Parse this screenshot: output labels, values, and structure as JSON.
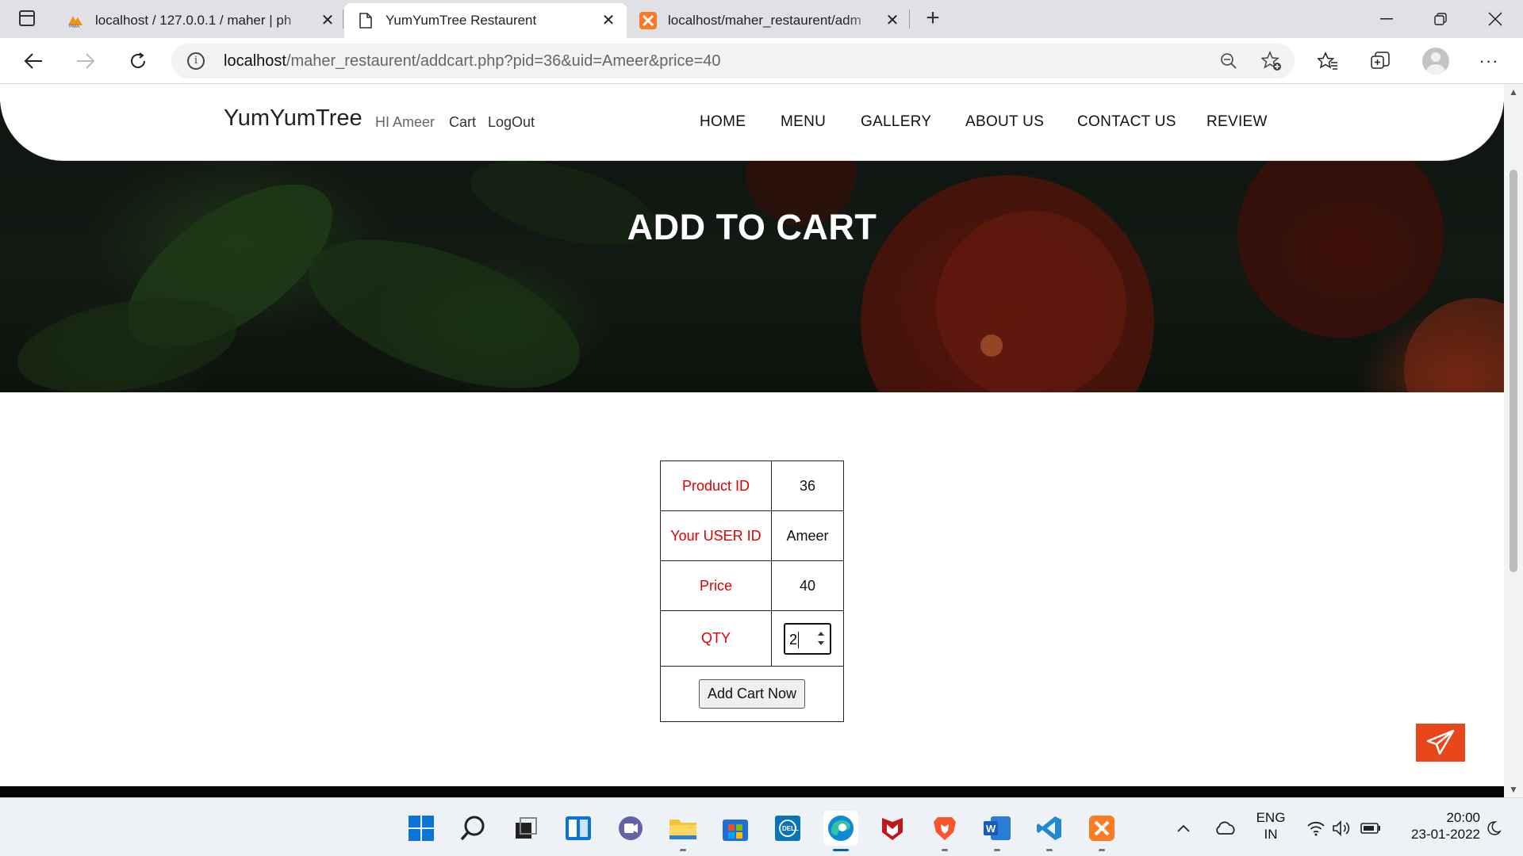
{
  "browser": {
    "tabs": [
      {
        "title": "localhost / 127.0.0.1 / maher | ph",
        "icon": "phpmyadmin-icon",
        "active": false
      },
      {
        "title": "YumYumTree Restaurent",
        "icon": "page-icon",
        "active": true
      },
      {
        "title": "localhost/maher_restaurent/adm",
        "icon": "xampp-icon",
        "active": false
      }
    ],
    "url_host": "localhost",
    "url_path": "/maher_restaurent/addcart.php?pid=36&uid=Ameer&price=40"
  },
  "navbar": {
    "brand": "YumYumTree",
    "greeting": "HI Ameer",
    "cart_label": "Cart",
    "logout_label": "LogOut",
    "links": [
      "HOME",
      "MENU",
      "GALLERY",
      "ABOUT US",
      "CONTACT US",
      "REVIEW"
    ]
  },
  "hero": {
    "title": "ADD TO CART"
  },
  "cart_form": {
    "product_id_label": "Product ID",
    "product_id": "36",
    "user_id_label": "Your USER ID",
    "user_id": "Ameer",
    "price_label": "Price",
    "price": "40",
    "qty_label": "QTY",
    "qty": "2",
    "submit_label": "Add Cart Now"
  },
  "colors": {
    "label_red": "#e00000",
    "send_button": "#e8461b"
  },
  "taskbar": {
    "lang_line1": "ENG",
    "lang_line2": "IN",
    "time": "20:00",
    "date": "23-01-2022"
  }
}
